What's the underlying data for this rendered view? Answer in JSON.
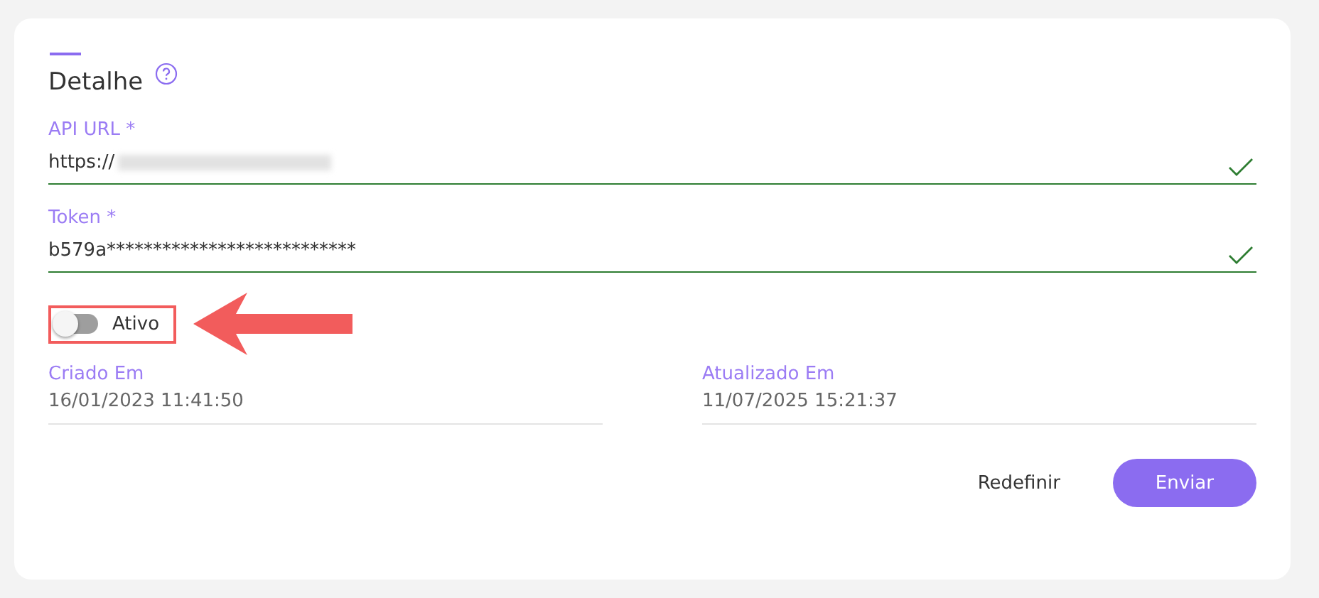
{
  "section": {
    "title": "Detalhe",
    "help_icon": true
  },
  "fields": [
    {
      "label": "API URL *",
      "value": "https://",
      "redacted": true,
      "valid": true
    },
    {
      "label": "Token *",
      "value": "b579a***************************",
      "redacted": false,
      "valid": true
    }
  ],
  "toggle": {
    "label": "Ativo",
    "on": false,
    "highlighted": true
  },
  "info": [
    {
      "label": "Criado Em",
      "value": "16/01/2023 11:41:50"
    },
    {
      "label": "Atualizado Em",
      "value": "11/07/2025 15:21:37"
    }
  ],
  "buttons": [
    {
      "label": "Redefinir",
      "kind": "text"
    },
    {
      "label": "Enviar",
      "kind": "primary"
    }
  ]
}
